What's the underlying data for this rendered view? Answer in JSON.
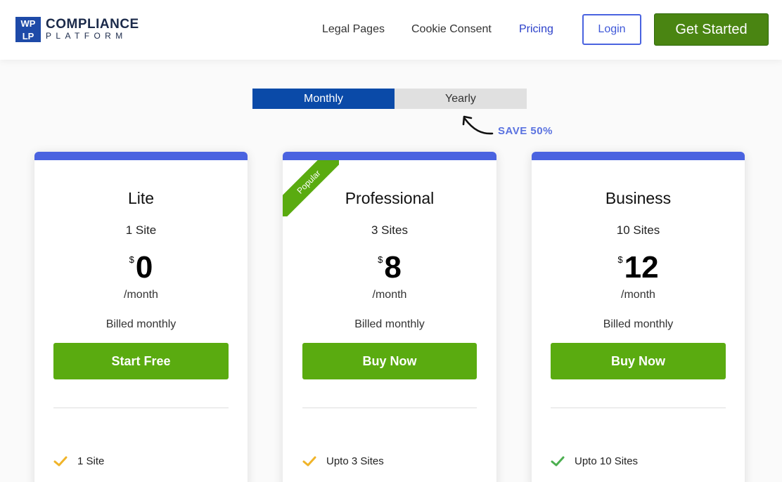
{
  "header": {
    "logo": {
      "mark": [
        "WP",
        "LP"
      ],
      "line1": "COMPLIANCE",
      "line2": "PLATFORM"
    },
    "nav": [
      "Legal Pages",
      "Cookie Consent",
      "Pricing"
    ],
    "login_label": "Login",
    "get_started_label": "Get Started"
  },
  "billing_toggle": {
    "monthly_label": "Monthly",
    "yearly_label": "Yearly",
    "selected": "Monthly",
    "save_note": "SAVE 50%"
  },
  "plans": [
    {
      "name": "Lite",
      "sites": "1 Site",
      "currency": "$",
      "price": "0",
      "period": "/month",
      "billed": "Billed monthly",
      "cta": "Start Free",
      "feature": "1 Site",
      "check_color": "#f0b429"
    },
    {
      "name": "Professional",
      "ribbon": "Popular",
      "sites": "3 Sites",
      "currency": "$",
      "price": "8",
      "period": "/month",
      "billed": "Billed monthly",
      "cta": "Buy Now",
      "feature": "Upto 3 Sites",
      "check_color": "#f0b429"
    },
    {
      "name": "Business",
      "sites": "10 Sites",
      "currency": "$",
      "price": "12",
      "period": "/month",
      "billed": "Billed monthly",
      "cta": "Buy Now",
      "feature": "Upto 10 Sites",
      "check_color": "#4caf50"
    }
  ],
  "colors": {
    "accent_blue": "#4a63e0",
    "toggle_active": "#0a4aa8",
    "cta_green": "#5aab10",
    "header_cta_green": "#4a8512"
  }
}
